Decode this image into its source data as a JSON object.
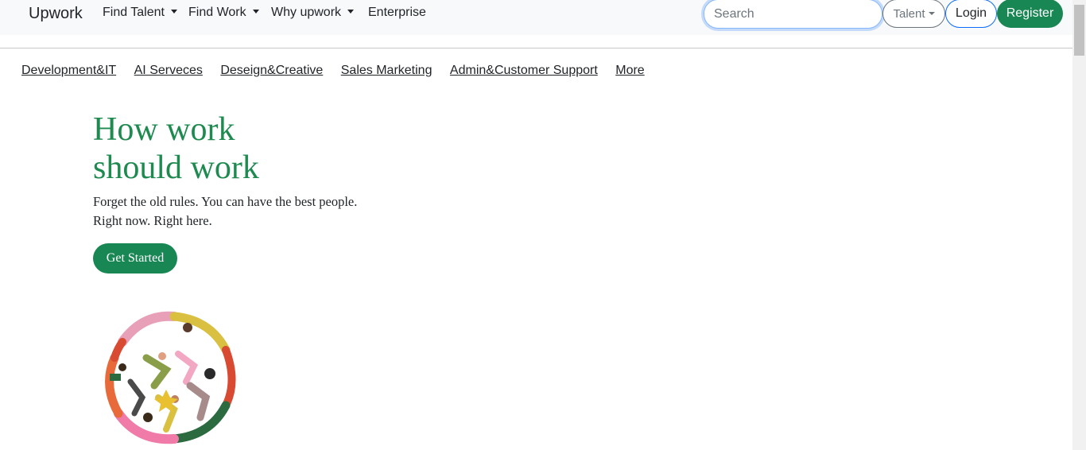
{
  "navbar": {
    "brand": "Upwork",
    "links": [
      {
        "label": "Find Talent",
        "dropdown": true
      },
      {
        "label": "Find Work",
        "dropdown": true
      },
      {
        "label": "Why upwork",
        "dropdown": true
      },
      {
        "label": "Enterprise",
        "dropdown": false
      }
    ],
    "search_placeholder": "Search",
    "talent_label": "Talent",
    "login_label": "Login",
    "register_label": "Register"
  },
  "categories": [
    "Development&IT",
    "AI Serveces",
    "Deseign&Creative",
    "Sales Marketing",
    "Admin&Customer Support",
    "More"
  ],
  "hero": {
    "title_line1": "How work",
    "title_line2": "should work",
    "subtitle_line1": "Forget the old rules. You can have the best people.",
    "subtitle_line2": "Right now. Right here.",
    "cta_label": "Get Started"
  },
  "colors": {
    "brand_green": "#198754",
    "title_green": "#1e8a50",
    "navbar_bg": "#f8f9fa"
  },
  "icons": {
    "dropdown": "caret-down-icon",
    "illustration": "people-circle-illustration"
  }
}
